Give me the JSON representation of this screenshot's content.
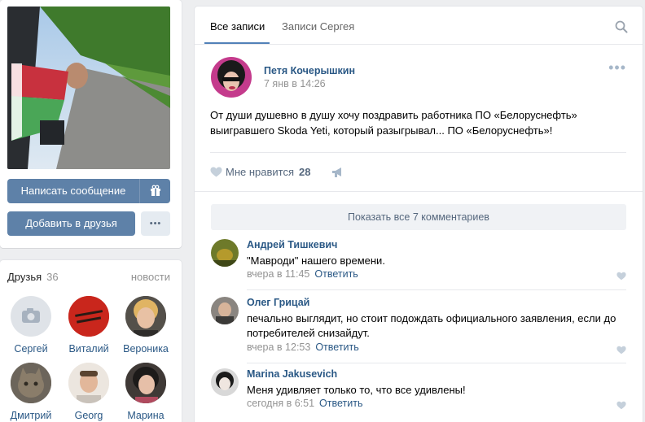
{
  "profile": {
    "send_message": "Написать сообщение",
    "add_friend": "Добавить в друзья",
    "more": "•••",
    "flag_colors": {
      "red": "#c8313e",
      "green": "#4aa657",
      "white": "#ffffff"
    }
  },
  "friends": {
    "title": "Друзья",
    "count": "36",
    "news_link": "новости",
    "items": [
      {
        "name": "Сергей"
      },
      {
        "name": "Виталий"
      },
      {
        "name": "Вероника"
      },
      {
        "name": "Дмитрий"
      },
      {
        "name": "Georg"
      },
      {
        "name": "Марина"
      }
    ]
  },
  "wall": {
    "tabs": [
      "Все записи",
      "Записи Сергея"
    ],
    "active_tab": "Все записи",
    "post": {
      "author": "Петя Кочерышкин",
      "date": "7 янв в 14:26",
      "text_line1": "От души душевно в душу хочу поздравить работника ПО «Белоруснефть»",
      "text_line2": "выигравшего Skoda Yeti, который разыгрывал... ПО «Белоруснефть»!",
      "like_label": "Мне нравится",
      "like_count": "28"
    },
    "show_all_comments": "Показать все 7 комментариев",
    "comments": [
      {
        "author": "Андрей Тишкевич",
        "text": "\"Мавроди\" нашего времени.",
        "time": "вчера в 11:45",
        "reply": "Ответить"
      },
      {
        "author": "Олег Грицай",
        "text": "печально выглядит, но стоит подождать официального заявления, если до потребителей снизайдут.",
        "time": "вчера в 12:53",
        "reply": "Ответить"
      },
      {
        "author": "Marina Jakusevich",
        "text": "Меня удивляет только то, что все удивлены!",
        "time": "сегодня в 6:51",
        "reply": "Ответить"
      }
    ]
  },
  "colors": {
    "accent": "#5e81a8",
    "link": "#2a5885",
    "muted": "#939393",
    "background": "#edeef0"
  }
}
